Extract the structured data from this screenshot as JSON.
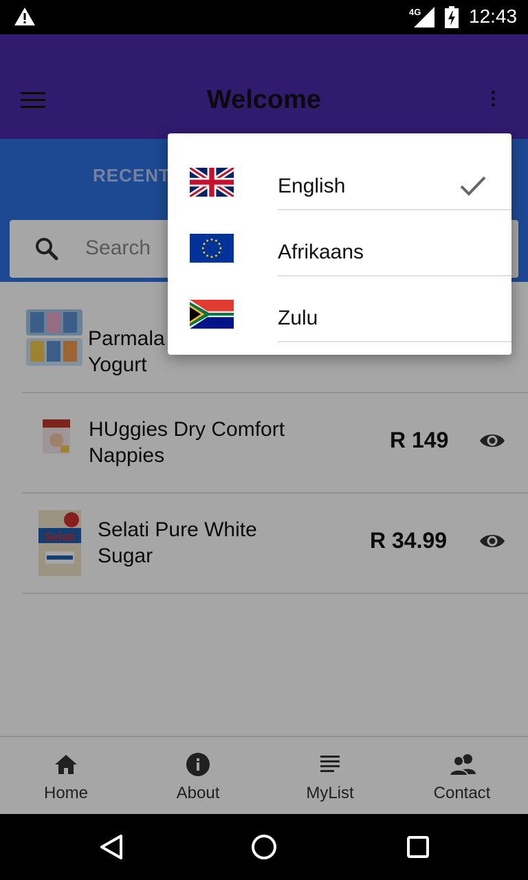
{
  "status_bar": {
    "network": "4G",
    "time": "12:43"
  },
  "app_bar": {
    "title": "Welcome",
    "menu_icon": "hamburger-menu-icon",
    "overflow_icon": "more-vert-icon"
  },
  "tabs": {
    "active_label": "RECENT"
  },
  "search": {
    "placeholder": "Search"
  },
  "products": [
    {
      "name_line1": "Parmala",
      "name_line2": "Yogurt",
      "price": ""
    },
    {
      "name_line1": "HUggies Dry Comfort",
      "name_line2": "Nappies",
      "price": "R 149"
    },
    {
      "name_line1": "Selati Pure White",
      "name_line2": "Sugar",
      "price": "R 34.99"
    }
  ],
  "bottom_nav": [
    {
      "label": "Home",
      "icon": "home-icon"
    },
    {
      "label": "About",
      "icon": "info-icon"
    },
    {
      "label": "MyList",
      "icon": "list-icon"
    },
    {
      "label": "Contact",
      "icon": "contacts-icon"
    }
  ],
  "language_menu": {
    "items": [
      {
        "label": "English",
        "flag": "uk-flag-icon",
        "selected": true
      },
      {
        "label": "Afrikaans",
        "flag": "eu-flag-icon",
        "selected": false
      },
      {
        "label": "Zulu",
        "flag": "south-africa-flag-icon",
        "selected": false
      }
    ]
  },
  "colors": {
    "app_bar": "#4a2aab",
    "tab_bar": "#2d6fe0"
  }
}
